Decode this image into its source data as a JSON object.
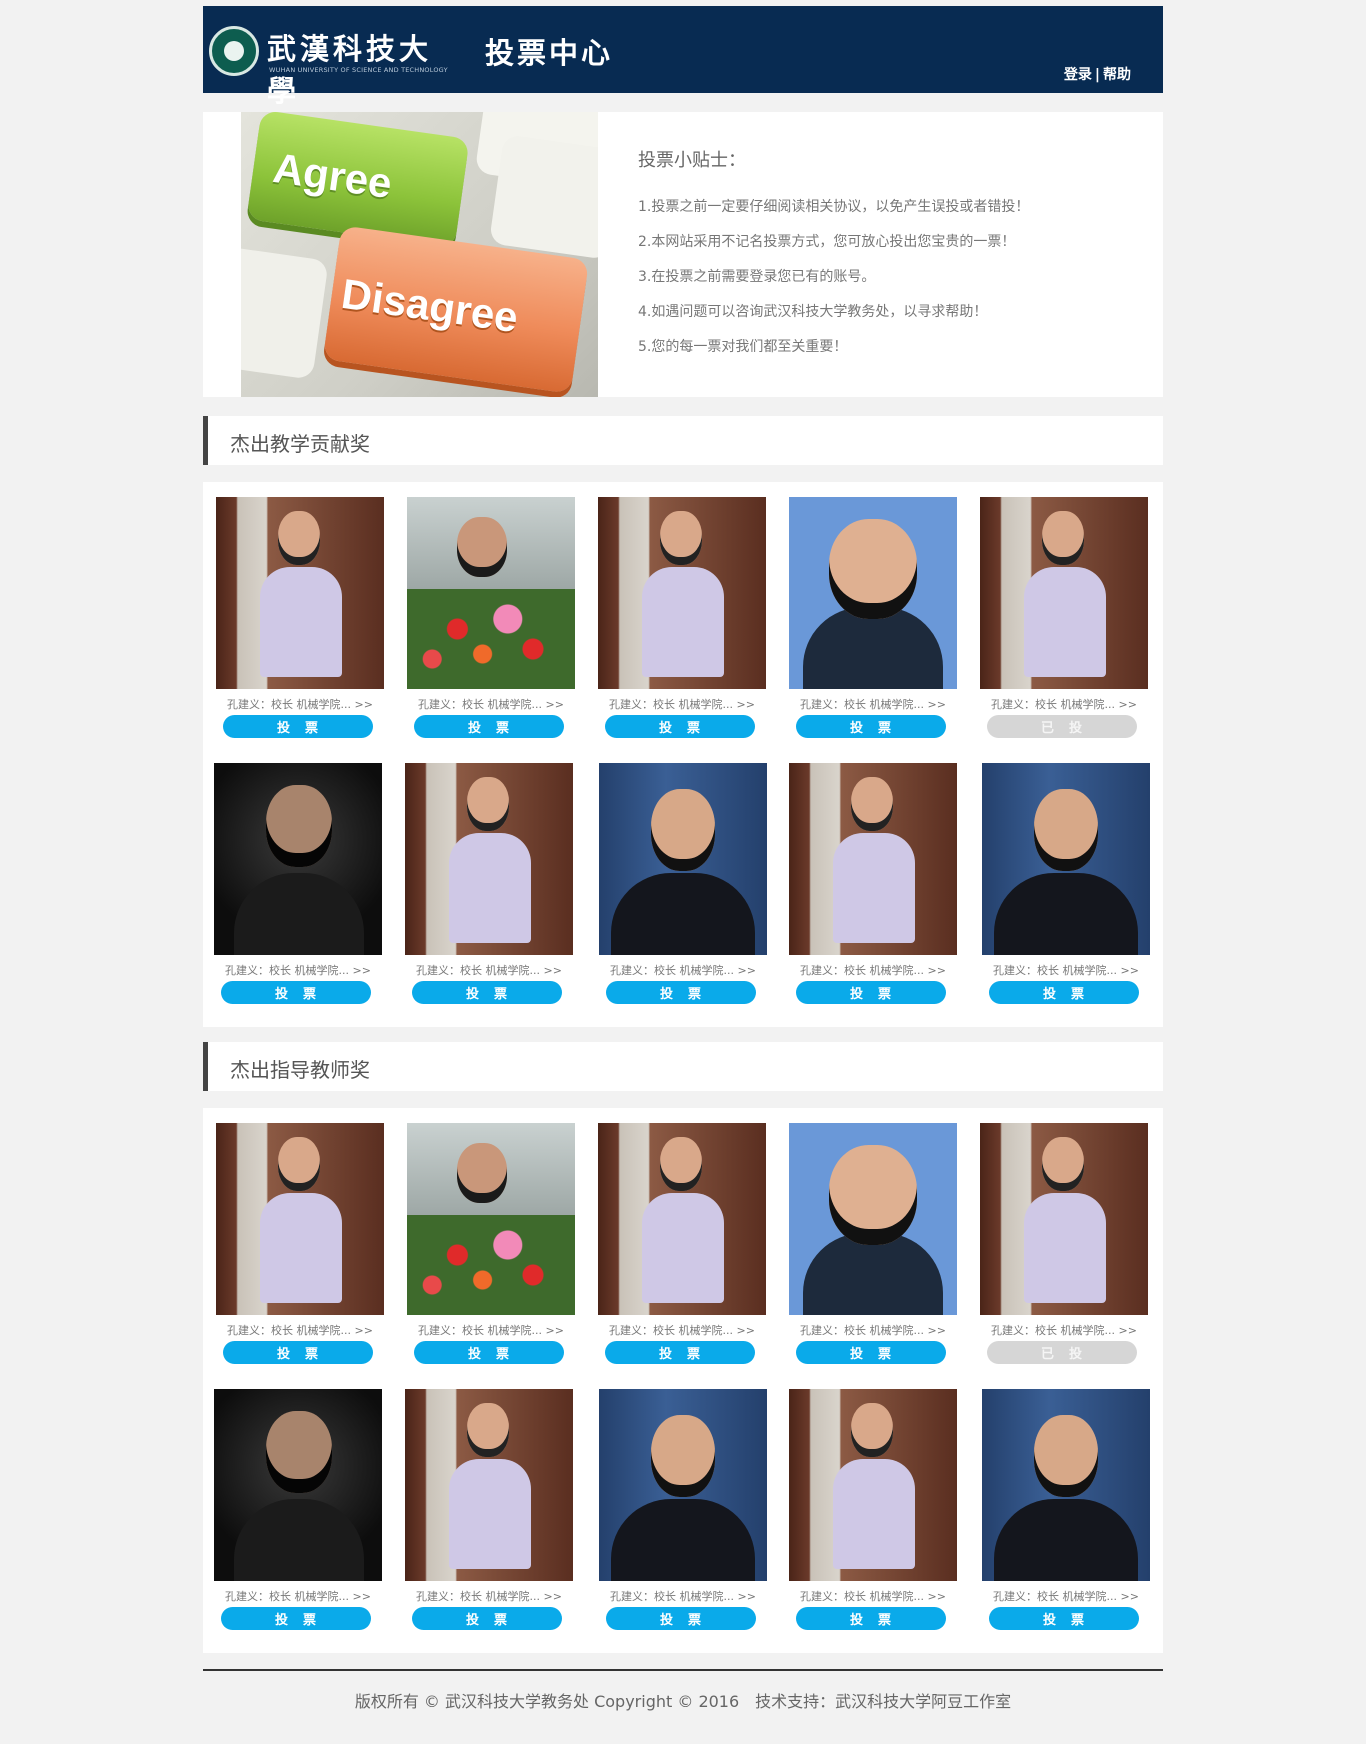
{
  "header": {
    "logo_cn": "武漢科技大學",
    "logo_en": "WUHAN UNIVERSITY OF SCIENCE AND TECHNOLOGY",
    "site_title": "投票中心",
    "login": "登录",
    "separator": "|",
    "help": "帮助"
  },
  "banner": {
    "key_agree": "Agree",
    "key_disagree": "Disagree",
    "tips_title": "投票小贴士：",
    "tips": [
      "1.投票之前一定要仔细阅读相关协议，以免产生误投或者错投！",
      "2.本网站采用不记名投票方式，您可放心投出您宝贵的一票！",
      "3.在投票之前需要登录您已有的账号。",
      "4.如遇问题可以咨询武汉科技大学教务处，以寻求帮助！",
      "5.您的每一票对我们都至关重要！"
    ]
  },
  "sections": [
    {
      "title": "杰出教学贡献奖",
      "cards": [
        {
          "caption": "孔建义：校长 机械学院... >>",
          "button": "投　票",
          "voted": false
        },
        {
          "caption": "孔建义：校长 机械学院... >>",
          "button": "投　票",
          "voted": false
        },
        {
          "caption": "孔建义：校长 机械学院... >>",
          "button": "投　票",
          "voted": false
        },
        {
          "caption": "孔建义：校长 机械学院... >>",
          "button": "投　票",
          "voted": false
        },
        {
          "caption": "孔建义：校长 机械学院... >>",
          "button": "已　投",
          "voted": true
        },
        {
          "caption": "孔建义：校长 机械学院... >>",
          "button": "投　票",
          "voted": false
        },
        {
          "caption": "孔建义：校长 机械学院... >>",
          "button": "投　票",
          "voted": false
        },
        {
          "caption": "孔建义：校长 机械学院... >>",
          "button": "投　票",
          "voted": false
        },
        {
          "caption": "孔建义：校长 机械学院... >>",
          "button": "投　票",
          "voted": false
        },
        {
          "caption": "孔建义：校长 机械学院... >>",
          "button": "投　票",
          "voted": false
        }
      ]
    },
    {
      "title": "杰出指导教师奖",
      "cards": [
        {
          "caption": "孔建义：校长 机械学院... >>",
          "button": "投　票",
          "voted": false
        },
        {
          "caption": "孔建义：校长 机械学院... >>",
          "button": "投　票",
          "voted": false
        },
        {
          "caption": "孔建义：校长 机械学院... >>",
          "button": "投　票",
          "voted": false
        },
        {
          "caption": "孔建义：校长 机械学院... >>",
          "button": "投　票",
          "voted": false
        },
        {
          "caption": "孔建义：校长 机械学院... >>",
          "button": "已　投",
          "voted": true
        },
        {
          "caption": "孔建义：校长 机械学院... >>",
          "button": "投　票",
          "voted": false
        },
        {
          "caption": "孔建义：校长 机械学院... >>",
          "button": "投　票",
          "voted": false
        },
        {
          "caption": "孔建义：校长 机械学院... >>",
          "button": "投　票",
          "voted": false
        },
        {
          "caption": "孔建义：校长 机械学院... >>",
          "button": "投　票",
          "voted": false
        },
        {
          "caption": "孔建义：校长 机械学院... >>",
          "button": "投　票",
          "voted": false
        }
      ]
    }
  ],
  "footer": {
    "text": "版权所有 © 武汉科技大学教务处 Copyright © 2016　技术支持：武汉科技大学阿豆工作室"
  },
  "colors": {
    "header_bg": "#082b52",
    "vote_button": "#0aaaea",
    "voted_button": "#d6d6d6",
    "page_bg": "#f2f2f2"
  }
}
